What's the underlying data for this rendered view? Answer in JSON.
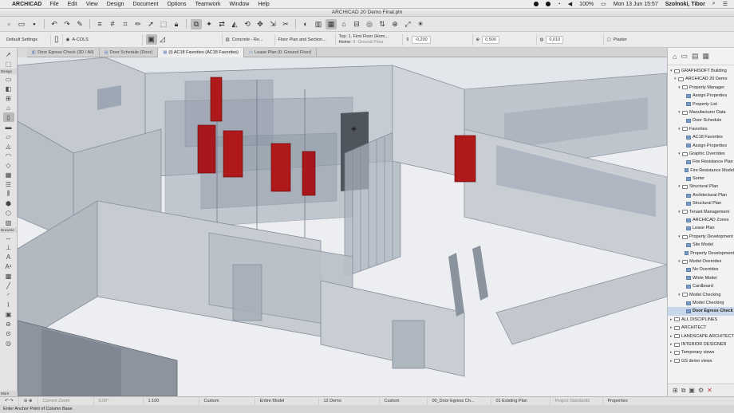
{
  "menubar": {
    "app": "ARCHICAD",
    "items": [
      "File",
      "Edit",
      "View",
      "Design",
      "Document",
      "Options",
      "Teamwork",
      "Window",
      "Help"
    ],
    "battery": "100%",
    "clock": "Mon 13 Jun  15:57",
    "user": "Szolnoki, Tibor"
  },
  "window": {
    "title": "ARCHICAD 20 Demo Final.pln"
  },
  "infobox": {
    "default_settings": "Default Settings",
    "layer": "A-COLS",
    "material": "Concrete - Re...",
    "view_mode": "Floor Plan and Section...",
    "top_label": "Top:",
    "top_value": "1. First Floor (Hom...",
    "home_label": "Home:",
    "home_value": "0. Ground Floor",
    "offset_top": "-0,200",
    "offset_bottom": "0,500",
    "height_value": "0,010",
    "finish": "Plaster"
  },
  "tabs": [
    {
      "label": "Door Egress Check (3D / All)",
      "active": false
    },
    {
      "label": "Door Schedule (Door)",
      "active": false
    },
    {
      "label": "(I) AC18 Favorites (AC18 Favorites)",
      "active": true
    },
    {
      "label": "Lease Plan (0. Ground Floor)",
      "active": false
    }
  ],
  "toolbox": {
    "design_label": "Design",
    "document_label": "Docume",
    "more_label": "More"
  },
  "navigator": {
    "tree": [
      {
        "level": 0,
        "type": "folder",
        "label": "GRAPHISOFT Building",
        "twisty": "▾"
      },
      {
        "level": 1,
        "type": "folder",
        "label": "ARCHICAD 20 Demo",
        "twisty": "▾"
      },
      {
        "level": 2,
        "type": "folder",
        "label": "Property Manager",
        "twisty": "▾"
      },
      {
        "level": 3,
        "type": "view",
        "label": "Assign Properties"
      },
      {
        "level": 3,
        "type": "view",
        "label": "Property List"
      },
      {
        "level": 2,
        "type": "folder",
        "label": "Manufacturer Data",
        "twisty": "▾"
      },
      {
        "level": 3,
        "type": "view",
        "label": "Door Schedule"
      },
      {
        "level": 2,
        "type": "folder",
        "label": "Favorites",
        "twisty": "▾"
      },
      {
        "level": 3,
        "type": "view",
        "label": "AC18 Favorites"
      },
      {
        "level": 3,
        "type": "view",
        "label": "Assign Properties"
      },
      {
        "level": 2,
        "type": "folder",
        "label": "Graphic Overrides",
        "twisty": "▾"
      },
      {
        "level": 3,
        "type": "view",
        "label": "Fire Resistance Plan"
      },
      {
        "level": 3,
        "type": "view",
        "label": "Fire Resistance Model"
      },
      {
        "level": 3,
        "type": "view",
        "label": "Sorter"
      },
      {
        "level": 2,
        "type": "folder",
        "label": "Structural Plan",
        "twisty": "▾"
      },
      {
        "level": 3,
        "type": "view",
        "label": "Architectural Plan"
      },
      {
        "level": 3,
        "type": "view",
        "label": "Structural Plan"
      },
      {
        "level": 2,
        "type": "folder",
        "label": "Tenant Management",
        "twisty": "▾"
      },
      {
        "level": 3,
        "type": "view",
        "label": "ARCHICAD Zones"
      },
      {
        "level": 3,
        "type": "view",
        "label": "Lease Plan"
      },
      {
        "level": 2,
        "type": "folder",
        "label": "Property Development",
        "twisty": "▾"
      },
      {
        "level": 3,
        "type": "view",
        "label": "Site Model"
      },
      {
        "level": 3,
        "type": "view",
        "label": "Property Development"
      },
      {
        "level": 2,
        "type": "folder",
        "label": "Model Overrides",
        "twisty": "▾"
      },
      {
        "level": 3,
        "type": "view",
        "label": "No Overrides"
      },
      {
        "level": 3,
        "type": "view",
        "label": "White Model"
      },
      {
        "level": 3,
        "type": "view",
        "label": "Cardboard"
      },
      {
        "level": 2,
        "type": "folder",
        "label": "Model Checking",
        "twisty": "▾"
      },
      {
        "level": 3,
        "type": "view",
        "label": "Model Checking"
      },
      {
        "level": 3,
        "type": "view",
        "label": "Door Egress Check",
        "selected": true
      },
      {
        "level": 0,
        "type": "folder",
        "label": "ALL DISCIPLINES",
        "twisty": "▸"
      },
      {
        "level": 0,
        "type": "folder",
        "label": "ARCHITECT",
        "twisty": "▸"
      },
      {
        "level": 0,
        "type": "folder",
        "label": "LANDSCAPE ARCHITECT",
        "twisty": "▸"
      },
      {
        "level": 0,
        "type": "folder",
        "label": "INTERIOR DESIGNER",
        "twisty": "▸"
      },
      {
        "level": 0,
        "type": "folder",
        "label": "Temporary views",
        "twisty": "▸"
      },
      {
        "level": 0,
        "type": "folder",
        "label": "GS demo views",
        "twisty": "▸"
      }
    ]
  },
  "bottombar": {
    "current_zoom": "Current Zoom",
    "angle": "0,00°",
    "scale": "1:100",
    "custom_1": "Custom",
    "entire_model": "Entire Model",
    "demo": "12 Demo",
    "custom_2": "Custom",
    "view_name": "00_Door Egress Ch...",
    "existing_plan": "01 Existing Plan",
    "project_standards": "Project Standards",
    "properties": "Properties"
  },
  "status": {
    "text": "Enter Anchor Point of Column Base."
  },
  "colors": {
    "door_red": "#b01919",
    "glass": "#9aa6b5",
    "viewport_bg": "#eef0f3"
  }
}
